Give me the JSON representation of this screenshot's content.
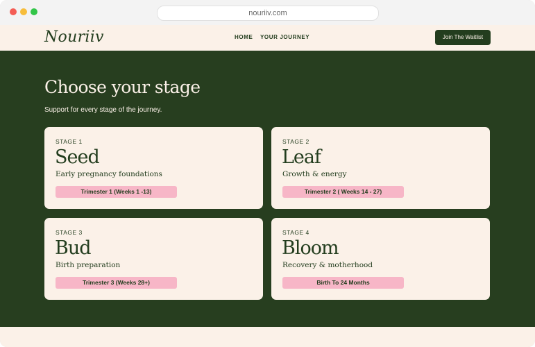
{
  "browser": {
    "url": "nouriiv.com"
  },
  "nav": {
    "logo": "Nouriiv",
    "links": [
      "HOME",
      "YOUR JOURNEY"
    ],
    "cta": "Join The Waitlist"
  },
  "hero": {
    "title": "Choose your stage",
    "subtitle": "Support for every stage of the journey."
  },
  "stages": [
    {
      "label": "STAGE 1",
      "name": "Seed",
      "description": "Early pregnancy foundations",
      "badge": "Trimester 1 (Weeks 1 -13)"
    },
    {
      "label": "STAGE 2",
      "name": "Leaf",
      "description": "Growth & energy",
      "badge": "Trimester 2 ( Weeks 14 - 27)"
    },
    {
      "label": "STAGE 3",
      "name": "Bud",
      "description": "Birth preparation",
      "badge": "Trimester 3 (Weeks 28+)"
    },
    {
      "label": "STAGE 4",
      "name": "Bloom",
      "description": "Recovery & motherhood",
      "badge": "Birth To 24 Months"
    }
  ],
  "colors": {
    "primary_green": "#273e1f",
    "cream": "#fbf1e8",
    "badge_pink": "#f7b6c7"
  }
}
